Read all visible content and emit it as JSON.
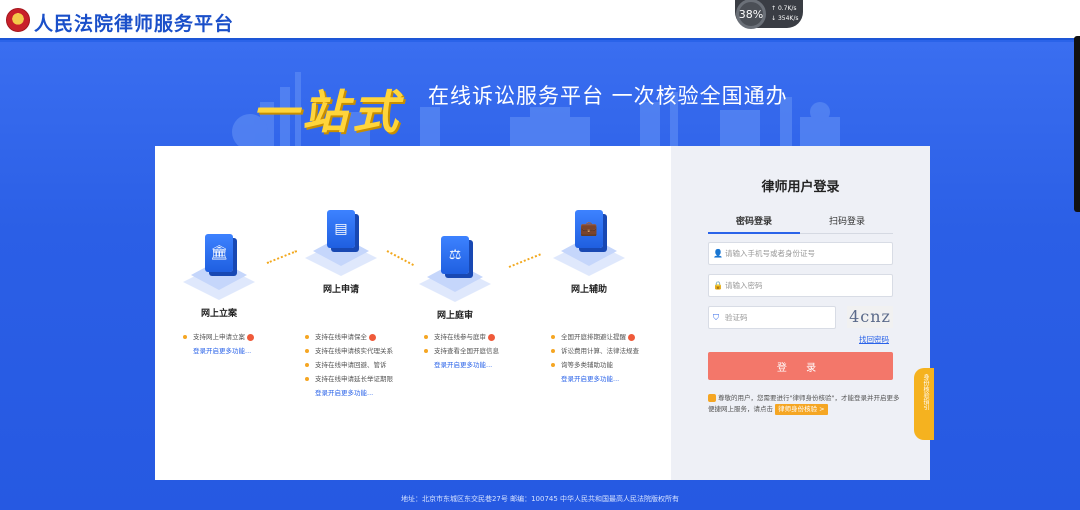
{
  "header": {
    "brand": "人民法院律师服务平台"
  },
  "speed_widget": {
    "percent": "38%",
    "up": "0.7K/s",
    "down": "354K/s"
  },
  "hero": {
    "big": "一站式",
    "sub": "在线诉讼服务平台  一次核验全国通办"
  },
  "services": [
    {
      "title": "网上立案",
      "icon": "courthouse-icon"
    },
    {
      "title": "网上申请",
      "icon": "document-icon"
    },
    {
      "title": "网上庭审",
      "icon": "gavel-icon"
    },
    {
      "title": "网上辅助",
      "icon": "briefcase-icon"
    }
  ],
  "features": {
    "lian": [
      "支持网上申请立案"
    ],
    "shenqing": [
      "支持在线申请保全",
      "支持在线申请核实代理关系",
      "支持在线申请回避、管诉",
      "支持在线申请延长举证期限"
    ],
    "tingshen": [
      "支持在线参与庭审",
      "支持查看全国开庭信息"
    ],
    "fuzhu": [
      "全国开庭排期避让提醒",
      "诉讼费用计算、法律法规查",
      "询等多类辅助功能"
    ],
    "more": "登录开启更多功能..."
  },
  "login": {
    "title": "律师用户登录",
    "tab_password": "密码登录",
    "tab_qr": "扫码登录",
    "phone_placeholder": "请输入手机号或者身份证号",
    "password_placeholder": "请输入密码",
    "captcha_placeholder": "验证码",
    "captcha_text": "4cnz",
    "forgot": "找回密码",
    "submit": "登 录",
    "notice": "尊敬的用户，您需要进行\"律师身份核验\"，才能登录并开启更多便捷网上服务，请点击",
    "notice_tag": "律师身份核验 >"
  },
  "sidetab": "身份核验指引",
  "footer": "地址：北京市东城区东交民巷27号    邮编：100745    中华人民共和国最高人民法院版权所有"
}
